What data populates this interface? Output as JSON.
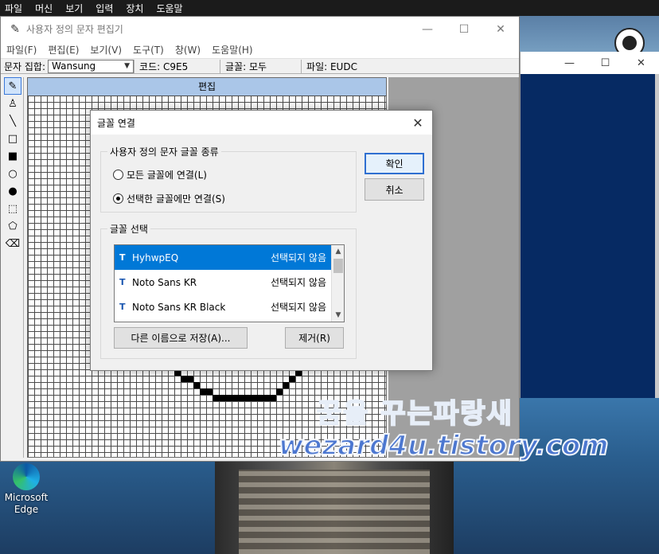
{
  "topbar": {
    "items": [
      "파일",
      "머신",
      "보기",
      "입력",
      "장치",
      "도움말"
    ]
  },
  "editor": {
    "title": "사용자 정의 문자 편집기",
    "menu": [
      "파일(F)",
      "편집(E)",
      "보기(V)",
      "도구(T)",
      "창(W)",
      "도움말(H)"
    ],
    "charset_label": "문자 집합:",
    "charset_value": "Wansung",
    "code": "코드: C9E5",
    "font": "글꼴: 모두",
    "file": "파일: EUDC",
    "grid_header": "편집",
    "window_buttons": {
      "minimize": "—",
      "maximize": "☐",
      "close": "✕"
    }
  },
  "dialog": {
    "title": "글꼴 연결",
    "close": "✕",
    "group1_label": "사용자 정의 문자 글꼴 종류",
    "radio_all": "모든 글꼴에 연결(L)",
    "radio_selected": "선택한 글꼴에만 연결(S)",
    "selected_radio": "selected",
    "ok": "확인",
    "cancel": "취소",
    "group2_label": "글꼴 선택",
    "fonts": [
      {
        "name": "HyhwpEQ",
        "status": "선택되지 않음",
        "selected": true
      },
      {
        "name": "Noto Sans KR",
        "status": "선택되지 않음",
        "selected": false
      },
      {
        "name": "Noto Sans KR Black",
        "status": "선택되지 않음",
        "selected": false
      }
    ],
    "save_as": "다른 이름으로 저장(A)...",
    "remove": "제거(R)"
  },
  "desktop": {
    "edge_label_1": "Microsoft",
    "edge_label_2": "Edge",
    "watermark_1": "꿈을 꾸는파랑새",
    "watermark_2": "wezard4u.tistory.com"
  },
  "colors": {
    "selection": "#0078d7",
    "grid_header": "#aac6e8",
    "dialog_bg": "#f0f0f0"
  }
}
